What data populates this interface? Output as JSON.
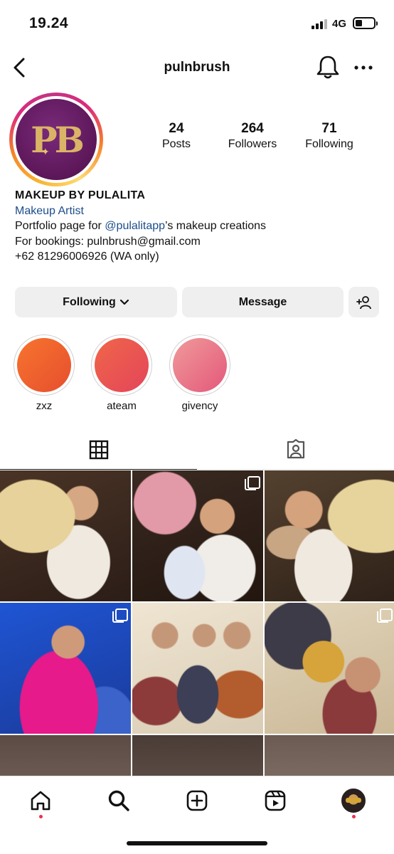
{
  "status_bar": {
    "time": "19.24",
    "network": "4G"
  },
  "header": {
    "username": "pulnbrush"
  },
  "profile": {
    "logo_text": "PB",
    "stats": [
      {
        "value": "24",
        "label": "Posts"
      },
      {
        "value": "264",
        "label": "Followers"
      },
      {
        "value": "71",
        "label": "Following"
      }
    ],
    "bio": {
      "name": "MAKEUP BY PULALITA",
      "category": "Makeup Artist",
      "line1_prefix": "Portfolio page for ",
      "line1_mention": "@pulalitapp",
      "line1_suffix": "’s makeup creations",
      "line2": "For bookings: pulnbrush@gmail.com",
      "line3": "+62 81296006926 (WA only)"
    }
  },
  "actions": {
    "following_label": "Following",
    "message_label": "Message"
  },
  "highlights": [
    {
      "label": "zxz",
      "color_a": "#f36a2a",
      "color_b": "#ea4f2f"
    },
    {
      "label": "ateam",
      "color_a": "#ea5a44",
      "color_b": "#e8475a"
    },
    {
      "label": "givency",
      "color_a": "#ec8a8f",
      "color_b": "#e55d75"
    }
  ],
  "grid": {
    "posts": [
      {
        "multi": false,
        "bg": "#3c2a22"
      },
      {
        "multi": true,
        "bg": "#2e201b"
      },
      {
        "multi": false,
        "bg": "#4a3a30"
      },
      {
        "multi": true,
        "bg": "#1f49b3"
      },
      {
        "multi": false,
        "bg": "#e7ddcb"
      },
      {
        "multi": true,
        "bg": "#d8c9ad"
      },
      {
        "multi": false,
        "bg": "#6a5a52"
      },
      {
        "multi": false,
        "bg": "#5c4d45"
      },
      {
        "multi": false,
        "bg": "#6f6058"
      }
    ]
  }
}
